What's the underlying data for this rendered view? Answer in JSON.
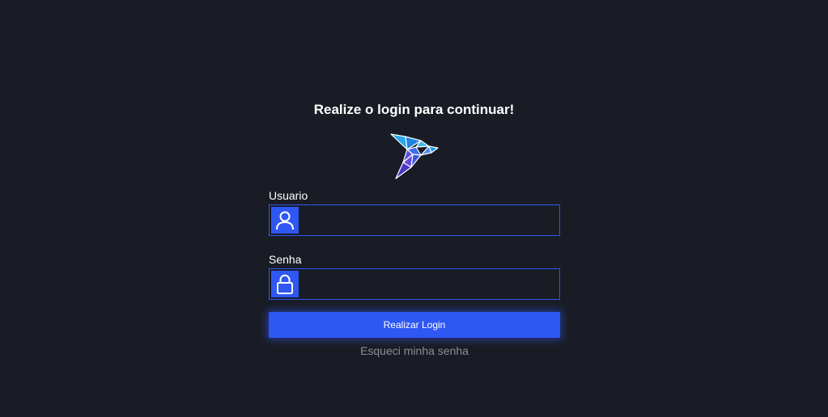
{
  "header": {
    "title": "Realize o login para continuar!"
  },
  "logo": {
    "icon": "origami-bird-icon"
  },
  "form": {
    "username": {
      "label": "Usuario",
      "icon": "user-icon",
      "value": "",
      "placeholder": ""
    },
    "password": {
      "label": "Senha",
      "icon": "lock-icon",
      "value": "",
      "placeholder": ""
    },
    "submit_label": "Realizar Login",
    "forgot_password_label": "Esqueci minha senha"
  },
  "colors": {
    "background": "#1a1c25",
    "accent": "#2e57f4",
    "text": "#ffffff",
    "muted_text": "#8c8e96"
  }
}
